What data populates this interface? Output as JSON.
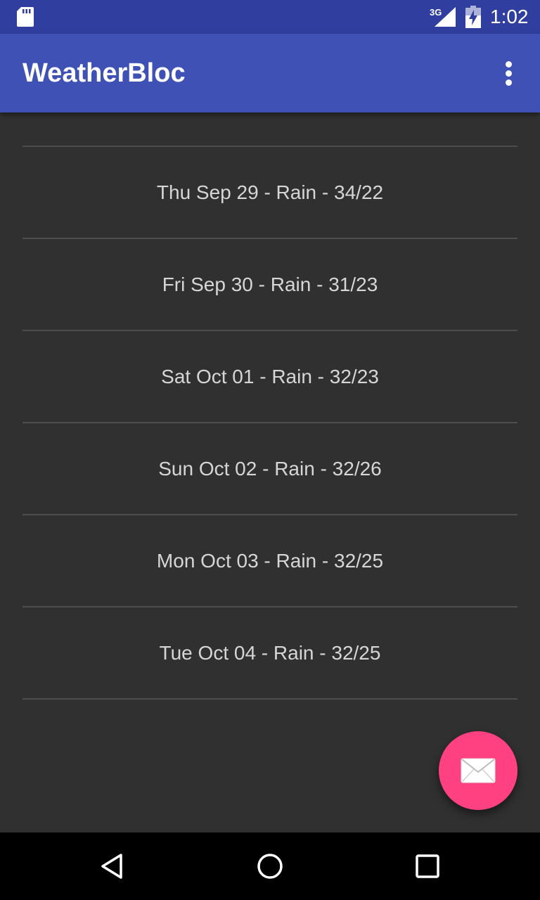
{
  "status_bar": {
    "network": "3G",
    "time": "1:02",
    "icons": [
      "sd-card-icon",
      "signal-icon",
      "battery-charging-icon"
    ]
  },
  "app_bar": {
    "title": "WeatherBloc",
    "overflow_icon": "more-vert-icon"
  },
  "forecast": [
    {
      "label": ""
    },
    {
      "label": "Thu Sep 29 - Rain - 34/22"
    },
    {
      "label": "Fri Sep 30 - Rain - 31/23"
    },
    {
      "label": "Sat Oct 01 - Rain - 32/23"
    },
    {
      "label": "Sun Oct 02 - Rain - 32/26"
    },
    {
      "label": "Mon Oct 03 - Rain - 32/25"
    },
    {
      "label": "Tue Oct 04 - Rain - 32/25"
    }
  ],
  "fab": {
    "icon": "mail-icon"
  },
  "nav_bar": {
    "icons": [
      "back-icon",
      "home-icon",
      "recents-icon"
    ]
  },
  "colors": {
    "status_bar": "#303f9f",
    "primary": "#3f51b5",
    "accent": "#ff4081",
    "background": "#303030",
    "divider": "#4d4d4d",
    "text": "#d6d6d6"
  }
}
